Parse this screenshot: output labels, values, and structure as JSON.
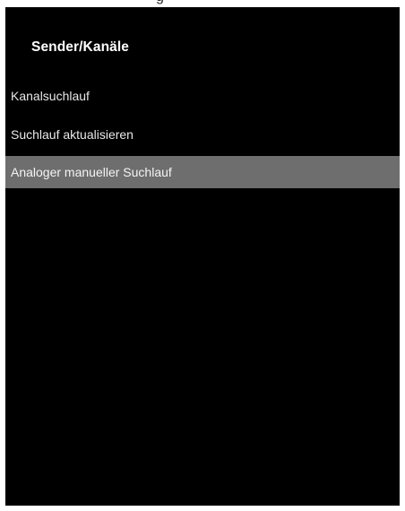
{
  "header": {
    "title": "Sender/Kanäle"
  },
  "menu": {
    "items": [
      {
        "label": "Kanalsuchlauf",
        "selected": false
      },
      {
        "label": "Suchlauf aktualisieren",
        "selected": false
      },
      {
        "label": "Analoger manueller Suchlauf",
        "selected": true
      }
    ]
  },
  "colors": {
    "background": "#000000",
    "highlight": "#6e6e6e",
    "text": "#ffffff"
  }
}
